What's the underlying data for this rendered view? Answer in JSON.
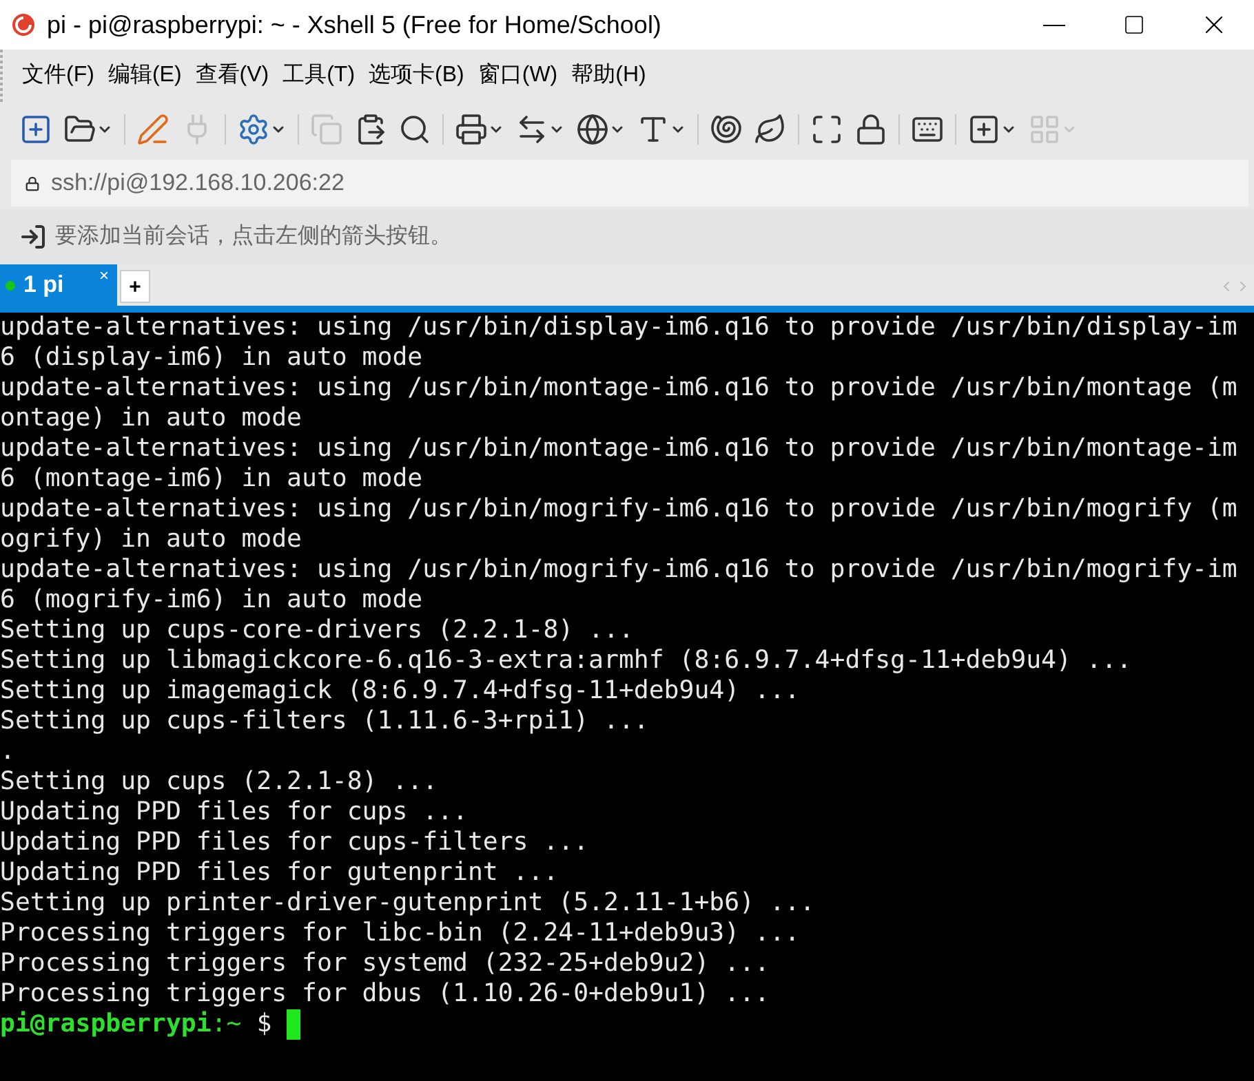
{
  "window": {
    "title": "pi - pi@raspberrypi: ~ - Xshell 5 (Free for Home/School)"
  },
  "menu": [
    "文件(F)",
    "编辑(E)",
    "查看(V)",
    "工具(T)",
    "选项卡(B)",
    "窗口(W)",
    "帮助(H)"
  ],
  "toolbar": [
    {
      "kind": "button",
      "disabled": false,
      "dropdown": false
    },
    {
      "kind": "button",
      "disabled": false,
      "dropdown": true
    },
    {
      "kind": "separator"
    },
    {
      "kind": "button",
      "disabled": false,
      "dropdown": false
    },
    {
      "kind": "button",
      "disabled": true,
      "dropdown": false
    },
    {
      "kind": "separator"
    },
    {
      "kind": "button",
      "disabled": false,
      "dropdown": true
    },
    {
      "kind": "separator"
    },
    {
      "kind": "button",
      "disabled": true,
      "dropdown": false
    },
    {
      "kind": "button",
      "disabled": false,
      "dropdown": false
    },
    {
      "kind": "button",
      "disabled": false,
      "dropdown": false
    },
    {
      "kind": "separator"
    },
    {
      "kind": "button",
      "disabled": false,
      "dropdown": true
    },
    {
      "kind": "button",
      "disabled": false,
      "dropdown": true
    },
    {
      "kind": "button",
      "disabled": false,
      "dropdown": true
    },
    {
      "kind": "button",
      "disabled": false,
      "dropdown": true
    },
    {
      "kind": "separator"
    },
    {
      "kind": "button",
      "disabled": false,
      "dropdown": false
    },
    {
      "kind": "button",
      "disabled": false,
      "dropdown": false
    },
    {
      "kind": "separator"
    },
    {
      "kind": "button",
      "disabled": false,
      "dropdown": false
    },
    {
      "kind": "button",
      "disabled": false,
      "dropdown": false
    },
    {
      "kind": "separator"
    },
    {
      "kind": "button",
      "disabled": false,
      "dropdown": false
    },
    {
      "kind": "separator"
    },
    {
      "kind": "button",
      "disabled": false,
      "dropdown": true
    },
    {
      "kind": "button",
      "disabled": true,
      "dropdown": true
    }
  ],
  "address": {
    "value": "ssh://pi@192.168.10.206:22"
  },
  "hint": "要添加当前会话，点击左侧的箭头按钮。",
  "tabs": [
    {
      "label": "1 pi",
      "selected": true,
      "connected": true,
      "close": "×"
    }
  ],
  "new_tab": "+",
  "terminal": {
    "lines": [
      "update-alternatives: using /usr/bin/display-im6.q16 to provide /usr/bin/display-im",
      "6 (display-im6) in auto mode",
      "update-alternatives: using /usr/bin/montage-im6.q16 to provide /usr/bin/montage (m",
      "ontage) in auto mode",
      "update-alternatives: using /usr/bin/montage-im6.q16 to provide /usr/bin/montage-im",
      "6 (montage-im6) in auto mode",
      "update-alternatives: using /usr/bin/mogrify-im6.q16 to provide /usr/bin/mogrify (m",
      "ogrify) in auto mode",
      "update-alternatives: using /usr/bin/mogrify-im6.q16 to provide /usr/bin/mogrify-im",
      "6 (mogrify-im6) in auto mode",
      "Setting up cups-core-drivers (2.2.1-8) ...",
      "Setting up libmagickcore-6.q16-3-extra:armhf (8:6.9.7.4+dfsg-11+deb9u4) ...",
      "Setting up imagemagick (8:6.9.7.4+dfsg-11+deb9u4) ...",
      "Setting up cups-filters (1.11.6-3+rpi1) ...",
      ".",
      "Setting up cups (2.2.1-8) ...",
      "Updating PPD files for cups ...",
      "Updating PPD files for cups-filters ...",
      "Updating PPD files for gutenprint ...",
      "Setting up printer-driver-gutenprint (5.2.11-1+b6) ...",
      "Processing triggers for libc-bin (2.24-11+deb9u3) ...",
      "Processing triggers for systemd (232-25+deb9u2) ...",
      "Processing triggers for dbus (1.10.26-0+deb9u1) ..."
    ],
    "prompt": {
      "user_host": "pi@raspberrypi",
      "path": ":~",
      "symbol": "$"
    }
  }
}
